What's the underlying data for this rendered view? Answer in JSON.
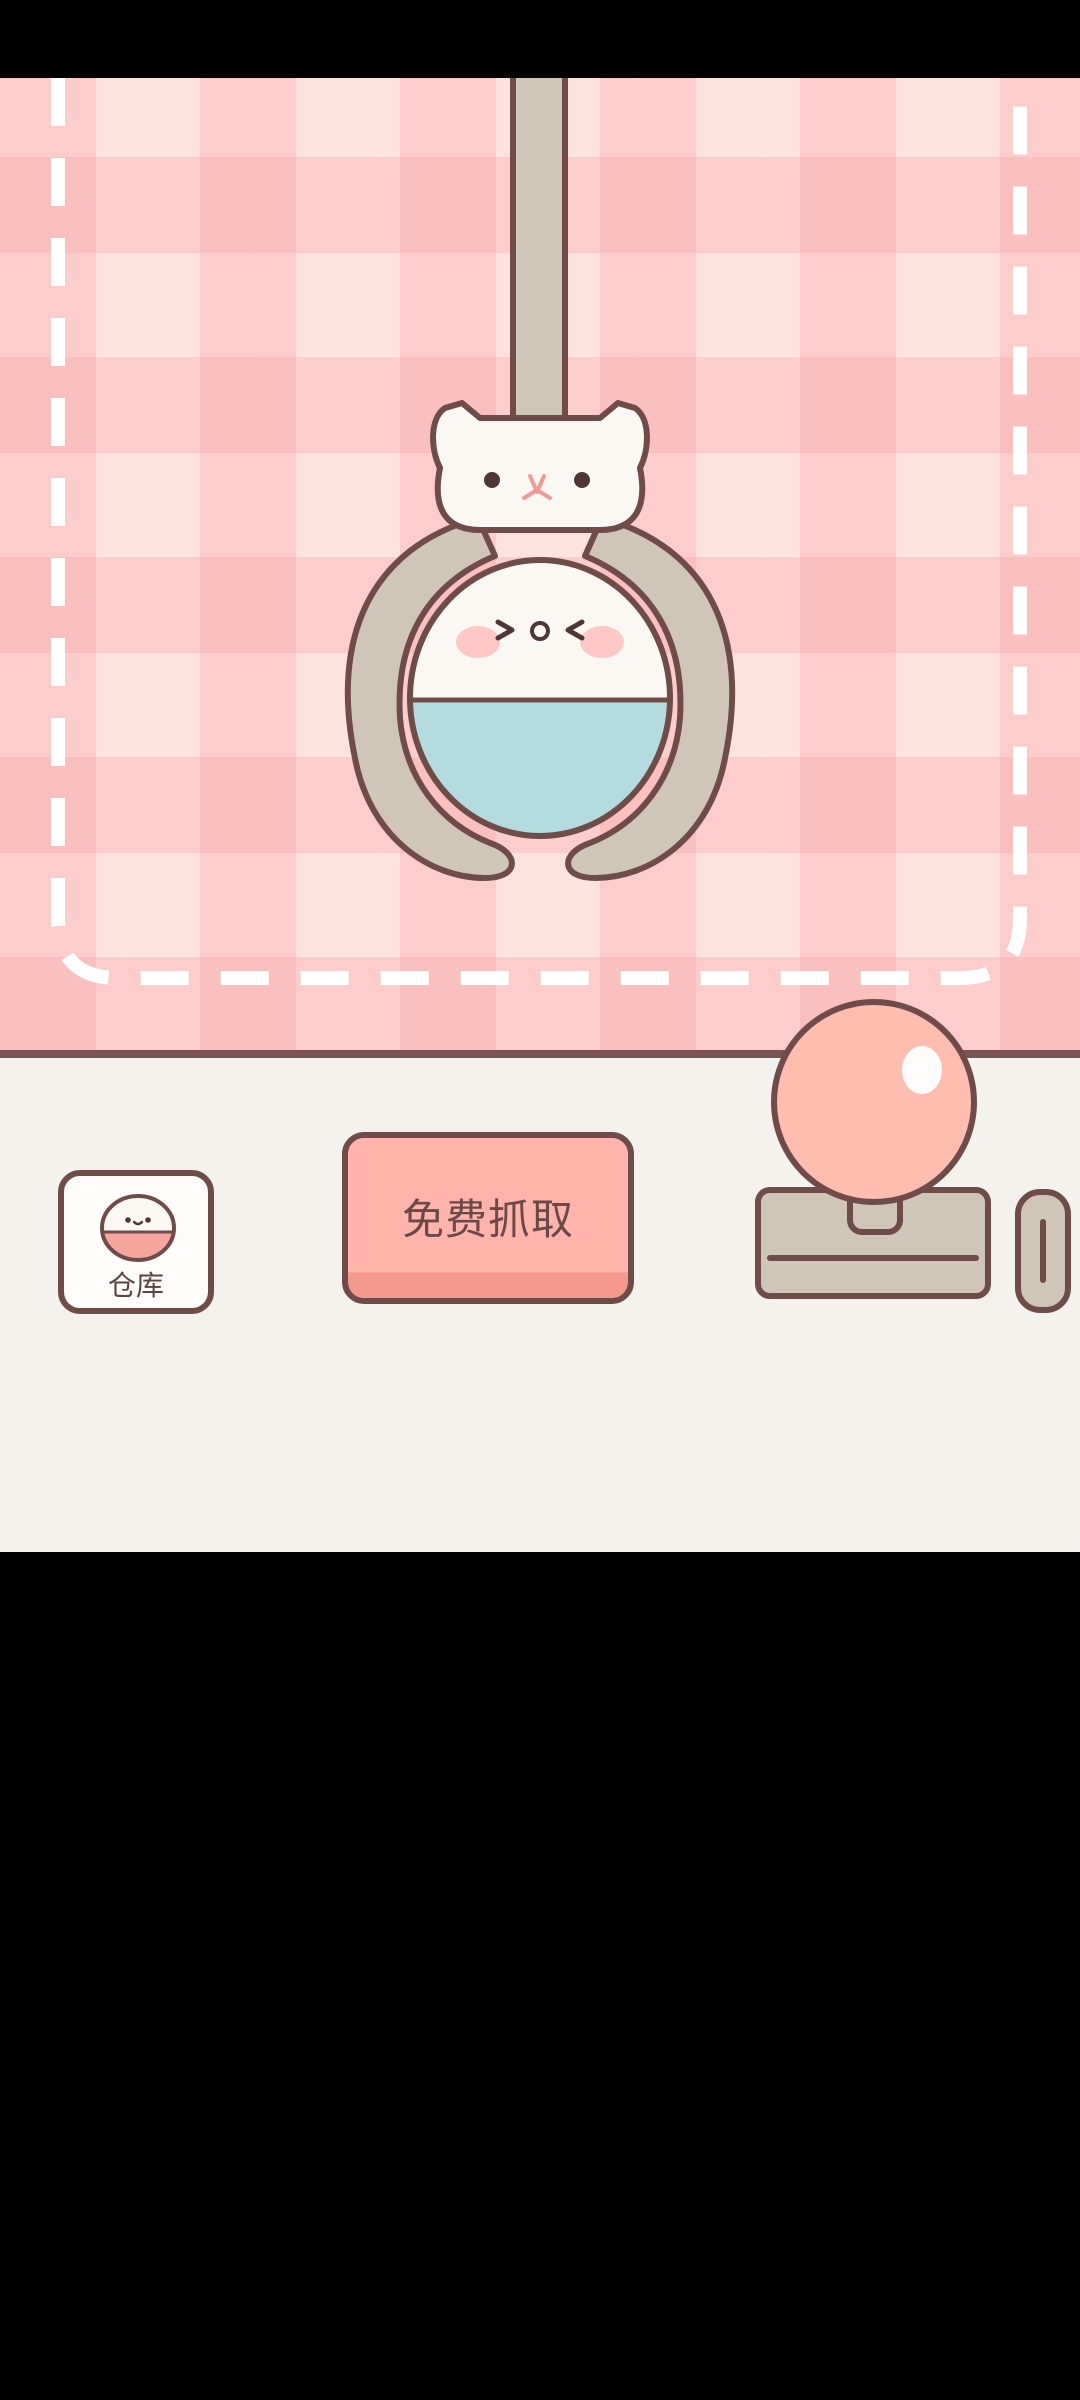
{
  "app": {
    "screen": "claw-machine"
  },
  "controls": {
    "warehouse_label": "仓库",
    "grab_label": "免费抓取"
  },
  "icons": {
    "claw": "cat-claw-icon",
    "prize": "round-blob-prize-icon",
    "warehouse": "blob-warehouse-icon",
    "joystick": "joystick-icon"
  },
  "colors": {
    "background_pink": "#fde2dd",
    "plaid_pink": "#f9aaaa",
    "outline_brown": "#6f4c48",
    "claw_grey": "#cfc6b8",
    "prize_blue": "#b4dbe0",
    "button_coral": "#ffb3aa",
    "joystick_ball": "#ffbdb0",
    "panel_cream": "#f5f2ee"
  }
}
